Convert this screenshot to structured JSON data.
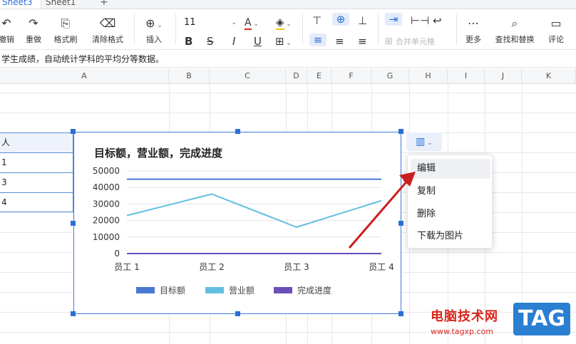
{
  "sheet_tabs": [
    {
      "label": "Sheet3",
      "active": true
    },
    {
      "label": "Sheet1",
      "active": false
    }
  ],
  "tab_add": "+",
  "toolbar": {
    "undo_label": "撤销",
    "redo_label": "重做",
    "format_painter_label": "格式刷",
    "clear_format_label": "清除格式",
    "insert_label": "插入",
    "font_size": "11",
    "bold": "B",
    "strikethrough": "S",
    "italic": "I",
    "underline": "U",
    "font_color_glyph": "A",
    "merge_cells_label": "合并单元格",
    "more_label": "更多",
    "find_replace_label": "查找和替换",
    "comment_label": "评论"
  },
  "formula_bar": {
    "text": "学生成绩，自动统计学科的平均分等数据。"
  },
  "columns": [
    "A",
    "B",
    "C",
    "D",
    "E",
    "F",
    "G",
    "H",
    "I",
    "J",
    "K"
  ],
  "cells": {
    "header": "人",
    "row1": "1",
    "row2": "3",
    "row3": "4"
  },
  "chart_data": {
    "type": "line",
    "title": "目标额，营业额，完成进度",
    "categories": [
      "员工 1",
      "员工 2",
      "员工 3",
      "员工 4"
    ],
    "ylim": [
      0,
      50000
    ],
    "yticks": [
      "50000",
      "40000",
      "30000",
      "20000",
      "10000",
      "0"
    ],
    "series": [
      {
        "name": "目标额",
        "values": [
          45000,
          45000,
          45000,
          45000
        ],
        "color": "#4a78d4"
      },
      {
        "name": "营业额",
        "values": [
          23000,
          36000,
          16000,
          32000
        ],
        "color": "#62bfe0"
      },
      {
        "name": "完成进度",
        "values": [
          0,
          0,
          0,
          0
        ],
        "color": "#6a4fb8"
      }
    ],
    "legend_position": "bottom",
    "grid": true
  },
  "chart_menu": {
    "items": [
      "编辑",
      "复制",
      "删除",
      "下载为图片"
    ],
    "highlighted": "编辑"
  },
  "watermark": {
    "text": "电脑技术网",
    "url": "www.tagxp.com",
    "logo": "TAG"
  },
  "colors": {
    "accent": "#2b6fd6",
    "arrow": "#c81f1f"
  }
}
